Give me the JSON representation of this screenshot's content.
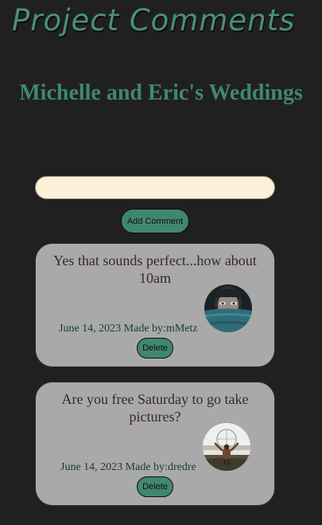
{
  "header": {
    "title": "Project Comments"
  },
  "project": {
    "title": "Michelle and Eric's Weddings"
  },
  "composer": {
    "input_value": "",
    "input_placeholder": "",
    "add_label": "Add Comment"
  },
  "comments": [
    {
      "text": "Yes that sounds perfect...how about 10am",
      "date": "June 14, 2023",
      "author_prefix": "Made by:",
      "author": "mMetz",
      "delete_label": "Delete"
    },
    {
      "text": "Are you free Saturday to go take pictures?",
      "date": "June 14, 2023",
      "author_prefix": "Made by:",
      "author": "dredre",
      "delete_label": "Delete"
    }
  ],
  "colors": {
    "background": "#202020",
    "accent_green": "#3f8770",
    "input_background": "#fbf0d8",
    "card_background": "#a9a9a9"
  }
}
